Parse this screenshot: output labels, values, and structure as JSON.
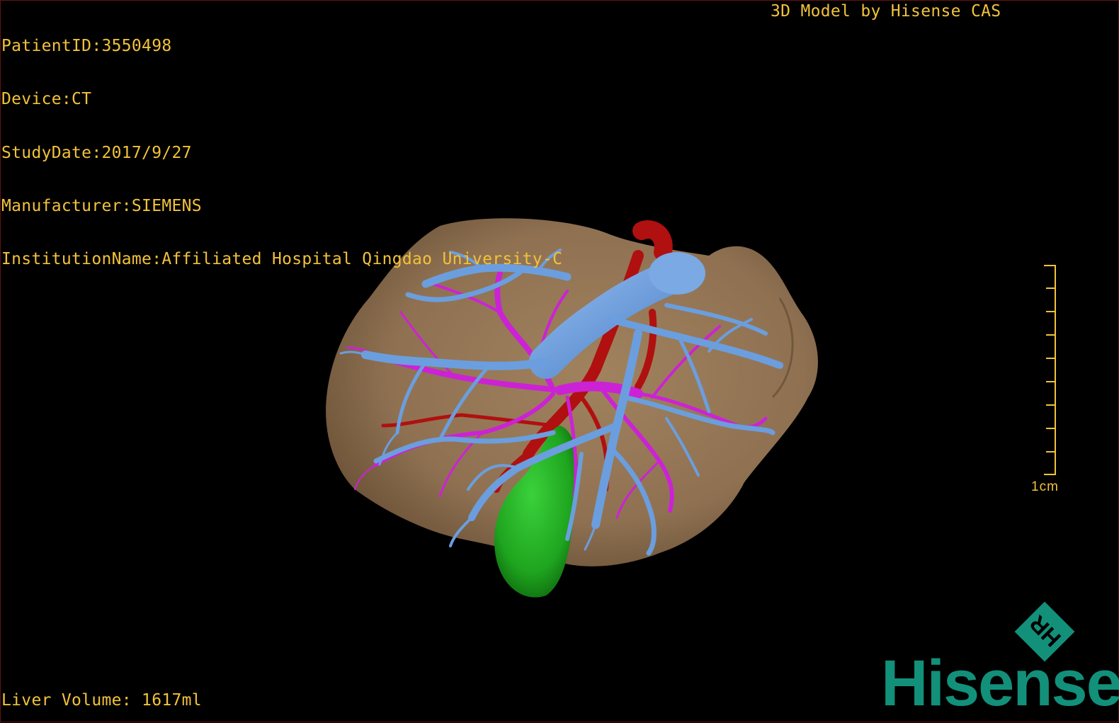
{
  "overlay": {
    "patient_id": "PatientID:3550498",
    "device": "Device:CT",
    "study_date": "StudyDate:2017/9/27",
    "manufacturer": "Manufacturer:SIEMENS",
    "institution": "InstitutionName:Affiliated Hospital Qingdao University-C",
    "brand_line": "3D Model by Hisense CAS",
    "liver_volume": "Liver Volume: 1617ml"
  },
  "scale": {
    "label": "1cm",
    "ticks": 10
  },
  "logo": {
    "mark_text": "HR",
    "wordmark": "Hisense"
  },
  "colors": {
    "text": "#f2c23a",
    "liver": "#8f7152",
    "portal_vein": "#6b9ede",
    "hepatic_artery": "#cc22d6",
    "hepatic_vein_red": "#b01010",
    "gallbladder": "#1fa51f",
    "brand": "#12907a"
  },
  "icons": {
    "logo_mark": "diamond-logo-icon",
    "scale": "scale-bar-icon"
  }
}
